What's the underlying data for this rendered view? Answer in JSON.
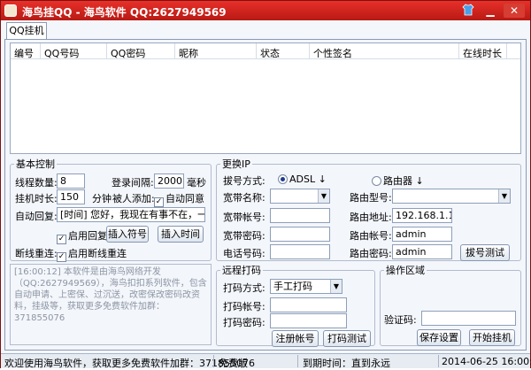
{
  "window": {
    "title": "海鸟挂QQ - 海鸟软件 QQ:2627949569",
    "buttons": [
      "shirt-icon",
      "minimize",
      "close"
    ]
  },
  "tab": {
    "label": "QQ挂机"
  },
  "table": {
    "headers": [
      "编号",
      "QQ号码",
      "QQ密码",
      "昵称",
      "状态",
      "个性签名",
      "在线时长"
    ]
  },
  "basic": {
    "legend": "基本控制",
    "thread_label": "线程数量:",
    "thread_value": "8",
    "login_interval_label": "登录间隔:",
    "login_interval_value": "2000",
    "ms_unit": "毫秒",
    "duration_label": "挂机时长:",
    "duration_value": "150",
    "minute_unit": "分钟",
    "added_label": "被人添加:",
    "auto_agree_label": "自动同意",
    "auto_reply_label": "自动回复:",
    "auto_reply_value": "[时间] 您好，我现在有事不在，一会再和",
    "enable_reply_label": "启用回复",
    "insert_symbol": "插入符号",
    "insert_time": "插入时间",
    "reconnect_label": "断线重连:",
    "enable_reconnect_label": "启用断线重连"
  },
  "ip": {
    "legend": "更换IP",
    "dial_mode_label": "拔号方式:",
    "adsl_label": "ADSL",
    "router_label": "路由器",
    "bb_name_label": "宽带名称:",
    "bb_account_label": "宽带帐号:",
    "bb_password_label": "宽带密码:",
    "phone_label": "电话号码:",
    "router_model_label": "路由型号:",
    "router_addr_label": "路由地址:",
    "router_addr_value": "192.168.1.1",
    "router_account_label": "路由帐号:",
    "router_account_value": "admin",
    "router_password_label": "路由密码:",
    "router_password_value": "admin",
    "dial_test": "拔号测试"
  },
  "captcha": {
    "legend": "远程打码",
    "mode_label": "打码方式:",
    "mode_value": "手工打码",
    "account_label": "打码帐号:",
    "password_label": "打码密码:",
    "register": "注册帐号",
    "test": "打码测试"
  },
  "ops": {
    "legend": "操作区域",
    "code_label": "验证码:",
    "save": "保存设置",
    "start": "开始挂机"
  },
  "log": {
    "text": "[16:00:12] 本软件是由海鸟网络开发（QQ:2627949569），海鸟扣扣系列软件，包含自动申请、上密保、过沉送，改密保改密码改资料，挂级等，获取更多免费软件加群：371855076"
  },
  "status": {
    "welcome": "欢迎使用海鸟软件，获取更多免费软件加群：371855076",
    "edition": "免费版",
    "expiry": "到期时间：直到永远",
    "datetime": "2014-06-25 16:00:16"
  },
  "colors": {
    "titlebar": "#c8231c",
    "accent": "#1a3d8f"
  }
}
